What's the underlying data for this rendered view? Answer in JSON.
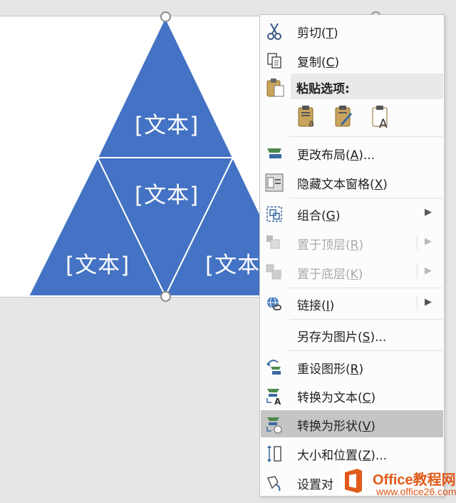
{
  "slide": {
    "texts": [
      "[文本]",
      "[文本]",
      "[文本]",
      "[文本]"
    ]
  },
  "colors": {
    "shape_fill": "#4472c4",
    "shape_line": "#ffffff",
    "menu_highlight": "#c5c5c5",
    "brand_orange": "#e15a1a"
  },
  "menu": {
    "cut": {
      "text": "剪切(",
      "key": "T",
      "end": ")",
      "icon": "scissors-icon"
    },
    "copy": {
      "text": "复制(",
      "key": "C",
      "end": ")",
      "icon": "copy-icon"
    },
    "paste_header": "粘贴选项:",
    "paste_options": [
      "paste-keep-source-icon",
      "paste-merge-icon",
      "paste-text-only-icon"
    ],
    "change_layout": {
      "text": "更改布局(",
      "key": "A",
      "end": ")...",
      "icon": "layout-icon"
    },
    "hide_text_pane": {
      "text": "隐藏文本窗格(",
      "key": "X",
      "end": ")",
      "icon": "text-pane-icon"
    },
    "group": {
      "text": "组合(",
      "key": "G",
      "end": ")",
      "icon": "group-icon"
    },
    "bring_front": {
      "text": "置于顶层(",
      "key": "R",
      "end": ")",
      "icon": "bring-front-icon"
    },
    "send_back": {
      "text": "置于底层(",
      "key": "K",
      "end": ")",
      "icon": "send-back-icon"
    },
    "link": {
      "text": "链接(",
      "key": "I",
      "end": ")",
      "icon": "link-icon"
    },
    "save_as_picture": {
      "text": "另存为图片(",
      "key": "S",
      "end": ")..."
    },
    "reset_graphic": {
      "text": "重设图形(",
      "key": "R",
      "end": ")",
      "icon": "reset-graphic-icon"
    },
    "convert_text": {
      "text": "转换为文本(",
      "key": "C",
      "end": ")",
      "icon": "convert-text-icon"
    },
    "convert_shapes": {
      "text": "转换为形状(",
      "key": "V",
      "end": ")",
      "icon": "convert-shapes-icon"
    },
    "size_position": {
      "text": "大小和位置(",
      "key": "Z",
      "end": ")...",
      "icon": "size-position-icon"
    },
    "format_object": {
      "text": "设置对",
      "icon": "format-object-icon"
    }
  },
  "watermark": {
    "title": "Office教程网",
    "url": "www.office26.com"
  }
}
